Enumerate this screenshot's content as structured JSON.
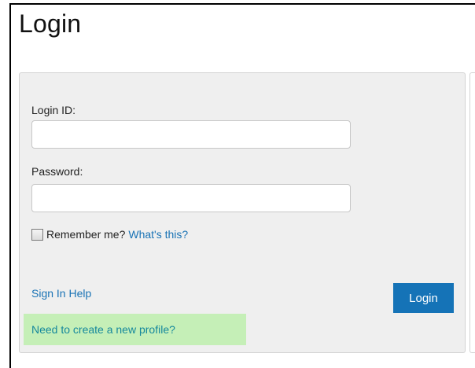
{
  "page": {
    "title": "Login"
  },
  "form": {
    "login_id_label": "Login ID:",
    "login_id_value": "",
    "password_label": "Password:",
    "password_value": "",
    "remember_checked": false,
    "remember_label": "Remember me?",
    "whats_this_link": "What's this?",
    "sign_in_help_link": "Sign In Help",
    "login_button": "Login",
    "create_profile_link": "Need to create a new profile?"
  },
  "colors": {
    "button_bg": "#1573b7",
    "link": "#1a73b5",
    "create_profile_bg": "#c5efb7",
    "panel_bg": "#efefef"
  }
}
